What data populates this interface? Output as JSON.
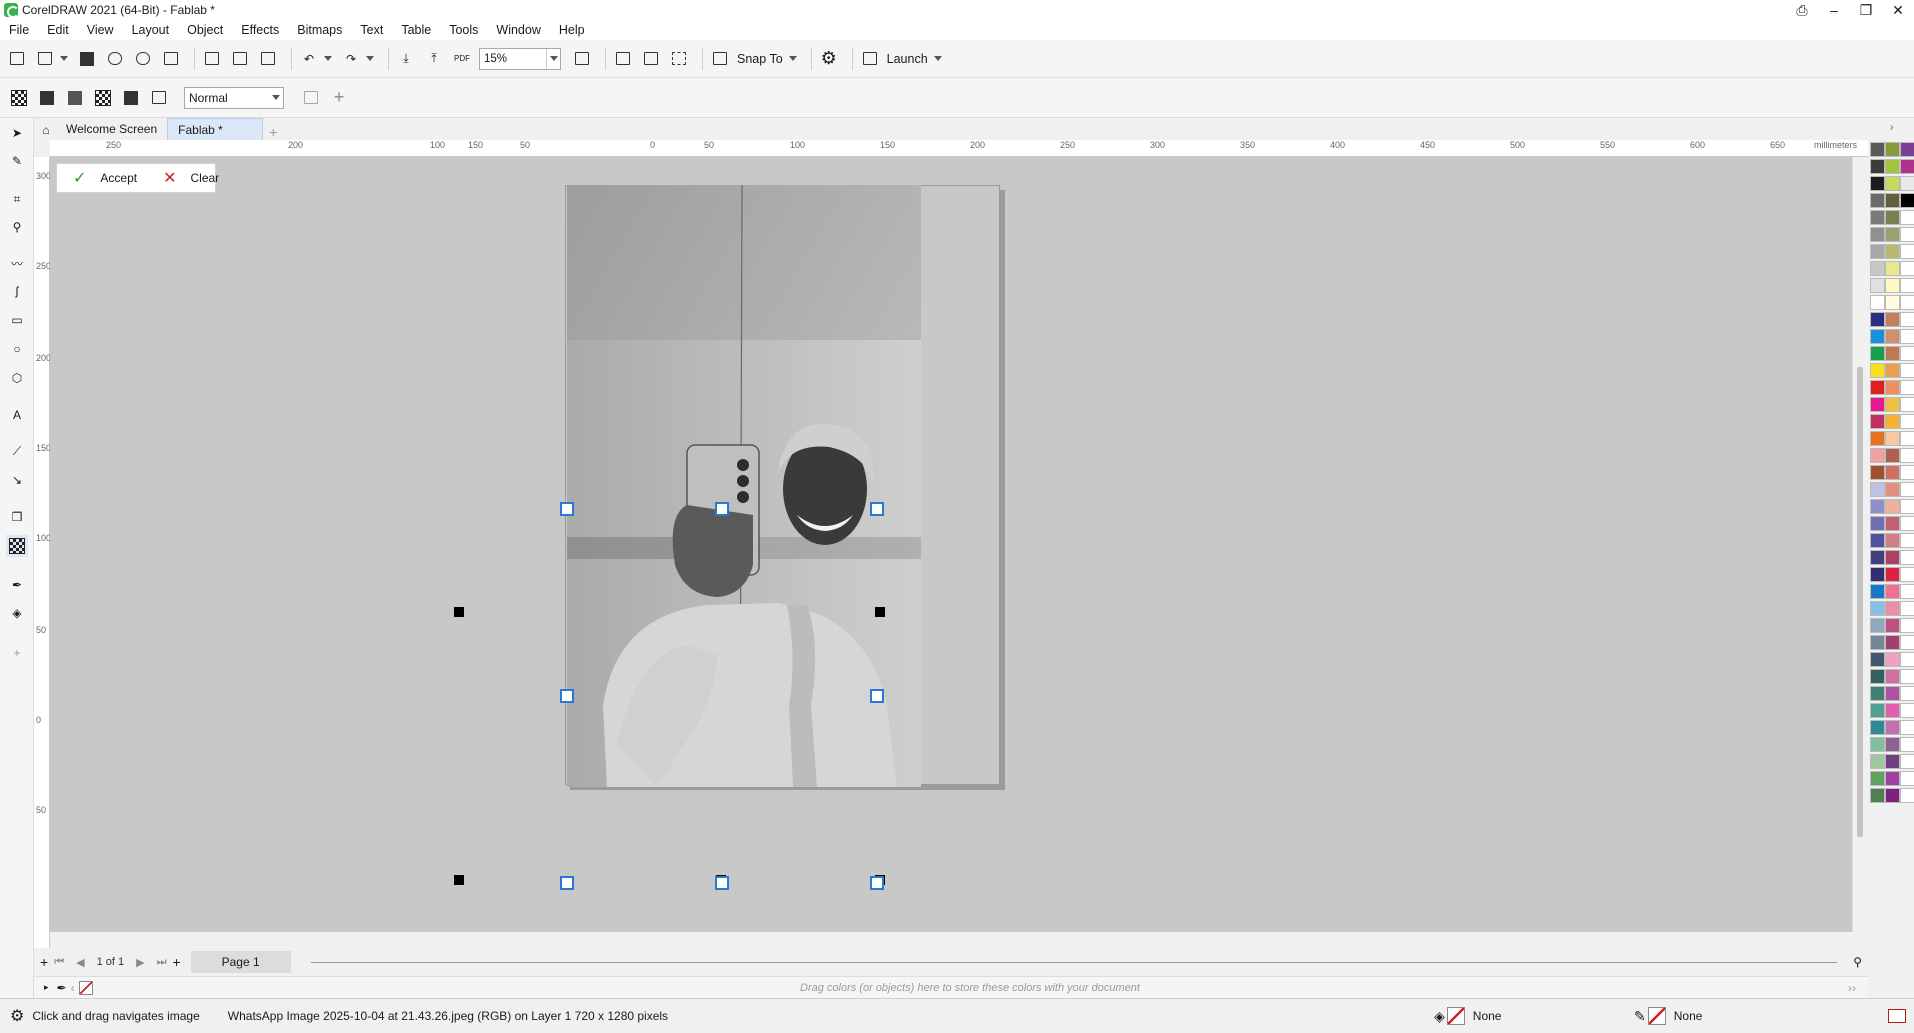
{
  "window": {
    "title": "CorelDRAW 2021 (64-Bit) - Fablab *"
  },
  "menu": [
    "File",
    "Edit",
    "View",
    "Layout",
    "Object",
    "Effects",
    "Bitmaps",
    "Text",
    "Table",
    "Tools",
    "Window",
    "Help"
  ],
  "toolbar": {
    "zoom": "15%",
    "snap_to": "Snap To",
    "launch": "Launch"
  },
  "propertybar": {
    "mode": "Normal"
  },
  "tabs": {
    "welcome": "Welcome Screen",
    "doc": "Fablab *"
  },
  "ruler": {
    "unit": "millimeters",
    "h_ticks": [
      "250",
      "200",
      "150",
      "100",
      "50",
      "0",
      "50",
      "100",
      "150",
      "200",
      "250",
      "300",
      "350",
      "400",
      "450",
      "500",
      "550",
      "600",
      "650"
    ],
    "v_ticks": [
      "300",
      "250",
      "200",
      "150",
      "100",
      "50",
      "0",
      "50"
    ]
  },
  "crop": {
    "accept": "Accept",
    "clear": "Clear"
  },
  "pages": {
    "counter": "1 of 1",
    "tab": "Page 1"
  },
  "docpalette": {
    "hint": "Drag colors (or objects) here to store these colors with your document"
  },
  "status": {
    "hint": "Click and drag navigates image",
    "info": "WhatsApp Image 2025-10-04 at 21.43.26.jpeg (RGB) on Layer 1 720 x 1280 pixels",
    "fill": "None",
    "outline": "None"
  },
  "palette_colors": [
    "#5a5a5a",
    "#8a9a3a",
    "#7b3f94",
    "#3c3c3c",
    "#a4c43c",
    "#b03090",
    "#1c1c1c",
    "#c8d860",
    "#e8e8e8",
    "#6a6a6a",
    "#606040",
    "#000000",
    "#7a7a7a",
    "#7a8050",
    "#ffffff",
    "#909090",
    "#9aa070",
    "#ffffff",
    "#a8a8a8",
    "#b8b870",
    "#ffffff",
    "#c8c8c8",
    "#e8e890",
    "#ffffff",
    "#e0e0e0",
    "#fff8c0",
    "#ffffff",
    "#ffffff",
    "#fffce0",
    "#ffffff",
    "#2a3080",
    "#c08060",
    "#ffffff",
    "#1a90d8",
    "#d09070",
    "#ffffff",
    "#18a050",
    "#c07850",
    "#ffffff",
    "#f8e020",
    "#e8a050",
    "#ffffff",
    "#e02020",
    "#f09060",
    "#ffffff",
    "#e81890",
    "#f0c040",
    "#ffffff",
    "#c03060",
    "#f8b030",
    "#ffffff",
    "#e87020",
    "#f8c8a0",
    "#ffffff",
    "#f0a0a0",
    "#b06050",
    "#ffffff",
    "#a05030",
    "#d07060",
    "#ffffff",
    "#c0c0e0",
    "#e09080",
    "#ffffff",
    "#9090c8",
    "#f0b0a0",
    "#ffffff",
    "#7070b0",
    "#c06070",
    "#ffffff",
    "#5050a0",
    "#d08080",
    "#ffffff",
    "#404080",
    "#b04060",
    "#ffffff",
    "#303070",
    "#e02040",
    "#ffffff",
    "#1878c8",
    "#f07090",
    "#ffffff",
    "#88c0e8",
    "#e890a8",
    "#ffffff",
    "#90a8c0",
    "#c05080",
    "#ffffff",
    "#708898",
    "#a04070",
    "#ffffff",
    "#405870",
    "#f0a0c0",
    "#ffffff",
    "#306060",
    "#d070a0",
    "#ffffff",
    "#408070",
    "#b050a0",
    "#ffffff",
    "#50a090",
    "#e060b0",
    "#ffffff",
    "#308898",
    "#c070b0",
    "#ffffff",
    "#80c0a0",
    "#906090",
    "#ffffff",
    "#a0c8a0",
    "#704080",
    "#ffffff",
    "#60a060",
    "#a040a0",
    "#ffffff",
    "#508050",
    "#802080",
    "#ffffff"
  ]
}
